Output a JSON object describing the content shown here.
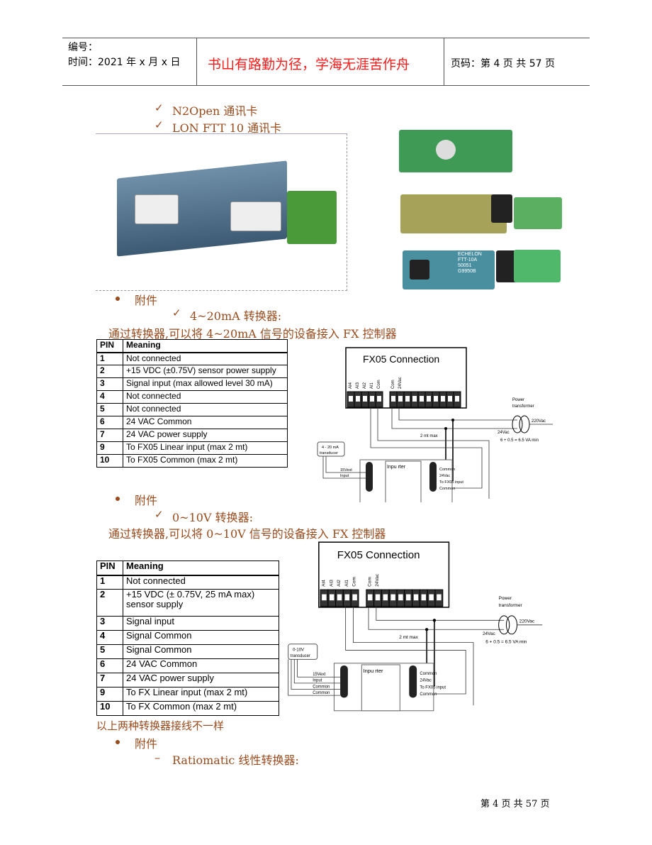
{
  "header": {
    "number_label": "编号：",
    "time_label": "时间：2021 年 x 月 x 日",
    "motto": "书山有路勤为径，学海无涯苦作舟",
    "page_label": "页码：第 4 页  共 57 页"
  },
  "section1": {
    "items": [
      "N2Open  通讯卡",
      "LON FTT 10 通讯卡"
    ],
    "photo_labels": [
      "ECHELON",
      "FTT-10A",
      "50051",
      "G9950B"
    ]
  },
  "accessory1": {
    "bullet": "附件",
    "item": "4~20mA 转换器:",
    "desc": "通过转换器,可以将 4~20mA 信号的设备接入 FX 控制器",
    "table": {
      "headers": [
        "PIN",
        "Meaning"
      ],
      "rows": [
        [
          "1",
          "Not connected"
        ],
        [
          "2",
          "+15 VDC (±0.75V) sensor power supply"
        ],
        [
          "3",
          "Signal input (max allowed level 30 mA)"
        ],
        [
          "4",
          "Not connected"
        ],
        [
          "5",
          "Not connected"
        ],
        [
          "6",
          "24 VAC Common"
        ],
        [
          "7",
          "24 VAC power supply"
        ],
        [
          "9",
          "To FX05 Linear input (max 2 mt)"
        ],
        [
          "10",
          "To FX05 Common (max 2 mt)"
        ]
      ]
    },
    "diagram": {
      "title": "FX05 Connection",
      "terminals": [
        "AI4",
        "AI3",
        "AI2",
        "AI1",
        "Com",
        "Com",
        "24Vac"
      ],
      "power": "Power",
      "transformer": "transformer",
      "v220": "220Vac",
      "v24": "24Vac",
      "va": "6 + 0.5 = 6.5 VA min",
      "max": "2 mt max",
      "transducer1": "4 - 20 mA",
      "transducer2": "transducer",
      "left_labels": [
        "15Vext",
        "Input"
      ],
      "right_labels": [
        "Common",
        "24Vac",
        "To FX05 input",
        "Common"
      ],
      "converter": "Inpu   rter"
    }
  },
  "accessory2": {
    "bullet": "附件",
    "item": "0~10V 转换器:",
    "desc": "通过转换器,可以将 0~10V 信号的设备接入 FX 控制器",
    "table": {
      "headers": [
        "PIN",
        "Meaning"
      ],
      "rows": [
        [
          "1",
          "Not connected"
        ],
        [
          "2",
          "+15 VDC (± 0.75V, 25 mA max) sensor supply"
        ],
        [
          "3",
          "Signal input"
        ],
        [
          "4",
          "Signal Common"
        ],
        [
          "5",
          "Signal Common"
        ],
        [
          "6",
          "24 VAC Common"
        ],
        [
          "7",
          "24 VAC power supply"
        ],
        [
          "9",
          "To FX Linear input (max 2 mt)"
        ],
        [
          "10",
          "To FX Common (max 2 mt)"
        ]
      ]
    },
    "diagram": {
      "title": "FX05 Connection",
      "terminals": [
        "AI4",
        "AI3",
        "AI2",
        "AI1",
        "Com",
        "Com",
        "24Vac"
      ],
      "power": "Power",
      "transformer": "transformer",
      "v220": "220Vac",
      "v24": "24Vac",
      "va": "6 + 0.5 = 6.5 VA min",
      "max": "2 mt max",
      "transducer1": "0-10V",
      "transducer2": "transducer",
      "left_labels": [
        "15Vext",
        "Input",
        "Common",
        "Common"
      ],
      "right_labels": [
        "Common",
        "24Vac",
        "To FX05 input",
        "Common"
      ],
      "converter": "Inpu   rter"
    }
  },
  "note": "以上两种转换器接线不一样",
  "accessory3": {
    "bullet": "附件",
    "item": "Ratiomatic 线性转换器:"
  },
  "footer": "第 4 页  共 57 页",
  "colors": {
    "text_brown": "#9a4a1c",
    "motto_red": "#ff1a1a"
  }
}
